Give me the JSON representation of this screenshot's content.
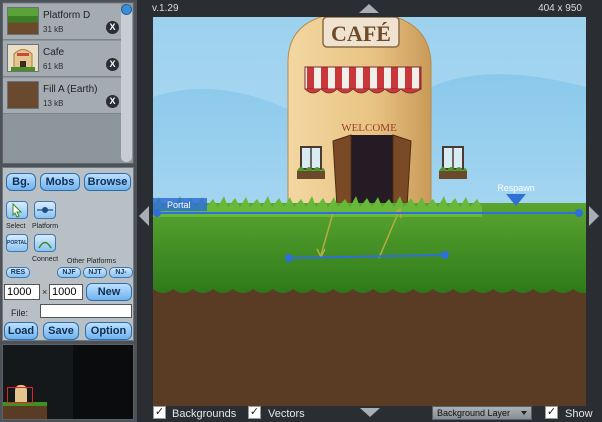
{
  "assets": [
    {
      "name": "Platform D",
      "size": "31 kB",
      "thumb": "platform-thumb"
    },
    {
      "name": "Cafe",
      "size": "61 kB",
      "thumb": "cafe-thumb"
    },
    {
      "name": "Fill A (Earth)",
      "size": "13 kB",
      "thumb": "earth-thumb"
    }
  ],
  "tools": {
    "bg_label": "Bg.",
    "mobs_label": "Mobs",
    "browse_label": "Browse",
    "select_label": "Select",
    "platform_label": "Platform",
    "portal_icon_text": "PORTAL",
    "connect_label": "Connect",
    "other_platforms_label": "Other Platforms",
    "res_label": "RES",
    "njf_label": "NJF",
    "njt_label": "NJT",
    "nj_label": "NJ-",
    "width_value": "1000",
    "times_label": "×",
    "height_value": "1000",
    "new_label": "New",
    "file_label": "File:",
    "file_value": "",
    "load_label": "Load",
    "save_label": "Save",
    "option_label": "Option"
  },
  "stage": {
    "version": "v.1.29",
    "dimensions": "404 x 950",
    "cafe_sign": "CAFÉ",
    "welcome_sign": "WELCOME",
    "portal_tag": "Portal",
    "respawn_tag": "Respawn"
  },
  "bottom": {
    "backgrounds_label": "Backgrounds",
    "backgrounds_checked": true,
    "vectors_label": "Vectors",
    "vectors_checked": true,
    "layer_select": "Background Layer",
    "show_label": "Show",
    "show_checked": true
  },
  "colors": {
    "sky": "#9fd4ef",
    "grass": "#3f8f22",
    "earth": "#5a3b23",
    "vector_line": "#2f6fd8",
    "connector": "#b2ad40",
    "accent_button": "#6fb2ee"
  }
}
